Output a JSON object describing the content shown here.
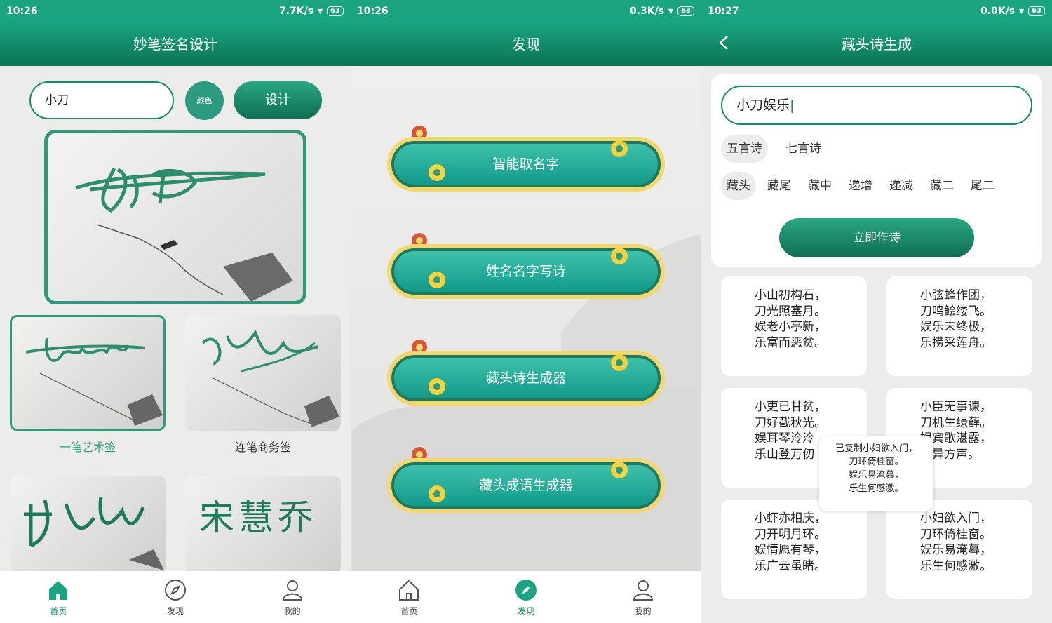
{
  "screens": [
    {
      "time": "10:26",
      "net": "7.7K/s",
      "battery": "63",
      "title": "妙笔签名设计"
    },
    {
      "time": "10:26",
      "net": "0.3K/s",
      "battery": "63",
      "title": "发现"
    },
    {
      "time": "10:27",
      "net": "0.0K/s",
      "battery": "63",
      "title": "藏头诗生成"
    }
  ],
  "home": {
    "name_value": "小刀",
    "color_label": "颜色",
    "design_label": "设计",
    "styles": [
      {
        "label": "一笔艺术签"
      },
      {
        "label": "连笔商务签"
      }
    ],
    "preview_glyphs": [
      "宋慧乔"
    ]
  },
  "discover": {
    "items": [
      "智能取名字",
      "姓名名字写诗",
      "藏头诗生成器",
      "藏头成语生成器"
    ]
  },
  "poem": {
    "input_value": "小刀娱乐",
    "length_types": [
      "五言诗",
      "七言诗"
    ],
    "modes": [
      "藏头",
      "藏尾",
      "藏中",
      "递增",
      "递减",
      "藏二",
      "尾二"
    ],
    "make_label": "立即作诗",
    "poems": [
      [
        "小山初构石，",
        "刀光照塞月。",
        "娱老小亭新，",
        "乐富而恶贫。"
      ],
      [
        "小弦蜂作团，",
        "刀鸣鲙缕飞。",
        "娱乐未终极，",
        "乐捞采莲舟。"
      ],
      [
        "小吏已甘贫，",
        "刀好截秋光。",
        "娱耳琴泠泠",
        "乐山登万仞"
      ],
      [
        "小臣无事谏，",
        "刀机生绿藓。",
        "娱宾歌湛露，",
        "杂异方声。"
      ],
      [
        "小虾亦相庆，",
        "刀开明月环。",
        "娱情愿有琴，",
        "乐广云虽睹。"
      ],
      [
        "小妇欲入门，",
        "刀环倚桂窗。",
        "娱乐易淹暮，",
        "乐生何感激。"
      ]
    ],
    "toast": [
      "已复制小妇欲入门，",
      "刀环倚桂窗。",
      "娱乐易淹暮，",
      "乐生何感激。"
    ]
  },
  "tabs": [
    "首页",
    "发现",
    "我的"
  ],
  "colors": {
    "accent": "#1aa481",
    "dark": "#0b7553"
  }
}
